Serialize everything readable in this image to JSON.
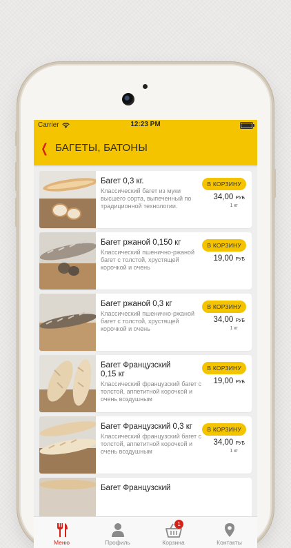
{
  "status_bar": {
    "carrier": "Carrier",
    "time": "12:23 PM"
  },
  "nav": {
    "back_icon": "chevron-left-icon",
    "title": "БАГЕТЫ, БАТОНЫ"
  },
  "products": [
    {
      "title": "Багет  0,3 кг.",
      "description": "Классический багет из муки высшего сорта, выпеченный по традиционной технологии.",
      "button": "В КОРЗИНУ",
      "price": "34,00",
      "currency": "РУБ",
      "unit": "1 кг"
    },
    {
      "title": "Багет ржаной 0,150 кг",
      "description": "Классический  пшенично-ржаной багет с толстой, хрустящей корочкой и очень",
      "button": "В КОРЗИНУ",
      "price": "19,00",
      "currency": "РУБ",
      "unit": ""
    },
    {
      "title": "Багет ржаной 0,3 кг",
      "description": "Классический  пшенично-ржаной багет с толстой, хрустящей корочкой и очень",
      "button": "В КОРЗИНУ",
      "price": "34,00",
      "currency": "РУБ",
      "unit": "1 кг"
    },
    {
      "title": "Багет Французский\n0,15 кг",
      "description": "Классический французский багет с толстой, аппетитной корочкой и очень воздушным",
      "button": "В КОРЗИНУ",
      "price": "19,00",
      "currency": "РУБ",
      "unit": ""
    },
    {
      "title": "Багет Французский 0,3 кг",
      "description": "Классический французский багет с толстой, аппетитной корочкой и очень воздушным",
      "button": "В КОРЗИНУ",
      "price": "34,00",
      "currency": "РУБ",
      "unit": "1 кг"
    },
    {
      "title": "Багет Французский",
      "description": "",
      "button": "",
      "price": "",
      "currency": "",
      "unit": ""
    }
  ],
  "tabbar": {
    "items": [
      {
        "label": "Меню",
        "icon": "fork-knife-icon",
        "active": true
      },
      {
        "label": "Профиль",
        "icon": "person-icon",
        "active": false
      },
      {
        "label": "Корзина",
        "icon": "basket-icon",
        "active": false,
        "badge": "1"
      },
      {
        "label": "Контакты",
        "icon": "location-pin-icon",
        "active": false
      }
    ]
  },
  "colors": {
    "accent": "#f5c400",
    "brand_red": "#d62218"
  }
}
